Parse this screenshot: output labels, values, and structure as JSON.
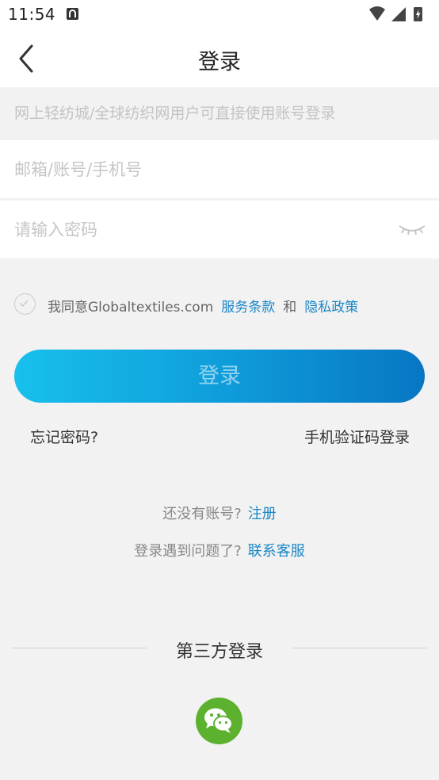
{
  "status_bar": {
    "time": "11:54"
  },
  "nav": {
    "title": "登录"
  },
  "notice": "网上轻纺城/全球纺织网用户可直接使用账号登录",
  "account_input": {
    "placeholder": "邮箱/账号/手机号",
    "value": ""
  },
  "password_input": {
    "placeholder": "请输入密码",
    "value": ""
  },
  "agreement": {
    "prefix": "我同意Globaltextiles.com",
    "terms": "服务条款",
    "and": "和",
    "privacy": "隐私政策"
  },
  "login_button": "登录",
  "forgot_password": "忘记密码?",
  "sms_login": "手机验证码登录",
  "register": {
    "prompt": "还没有账号?",
    "link": "注册"
  },
  "help": {
    "prompt": "登录遇到问题了?",
    "link": "联系客服"
  },
  "third_party": {
    "title": "第三方登录"
  },
  "colors": {
    "accent_blue": "#1a86c7",
    "button_gradient_start": "#18c0ec",
    "button_gradient_end": "#0876c4",
    "wechat_green": "#5cb22f"
  }
}
